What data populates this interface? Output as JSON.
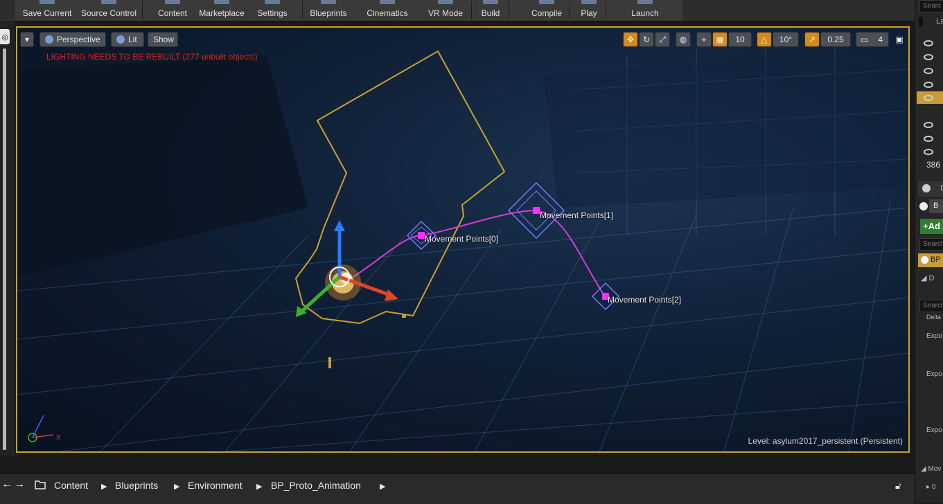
{
  "toolbar": {
    "buttons": [
      "Save Current",
      "Source Control",
      "Content",
      "Marketplace",
      "Settings",
      "Blueprints",
      "Cinematics",
      "VR Mode",
      "Build",
      "Compile",
      "Play",
      "Launch"
    ]
  },
  "viewport": {
    "view_mode": "Perspective",
    "lighting_mode": "Lit",
    "show_label": "Show",
    "warning": "LIGHTING NEEDS TO BE REBUILT (277 unbuilt objects)",
    "grid_snap": "10",
    "rotation_snap": "10°",
    "scale_snap": "0.25",
    "camera_speed": "4",
    "level_label": "Level:  asylum2017_persistent (Persistent)",
    "movement_points": [
      "Movement Points[0]",
      "Movement Points[1]",
      "Movement Points[2]"
    ],
    "axis_x": "X"
  },
  "right_panel": {
    "search_top": "Searc",
    "col_header": "La",
    "count": "386",
    "details_tab": "D",
    "bp_label": "B",
    "add_button": "+Ad",
    "search_mid": "Search",
    "bp_item": "BP",
    "tree_item": "D",
    "search_low": "Search",
    "delta": "Delta",
    "expo1": "Expo",
    "expo2": "Expo",
    "expo3": "Expo",
    "mov": "Mov",
    "zero": "0"
  },
  "breadcrumb": {
    "items": [
      "Content",
      "Blueprints",
      "Environment",
      "BP_Proto_Animation"
    ]
  },
  "colors": {
    "selection": "#c9a034",
    "warning": "#e0201d",
    "spline": "#d63bd6",
    "point": "#ff2fff",
    "gizmo_box": "#6f7dff"
  }
}
